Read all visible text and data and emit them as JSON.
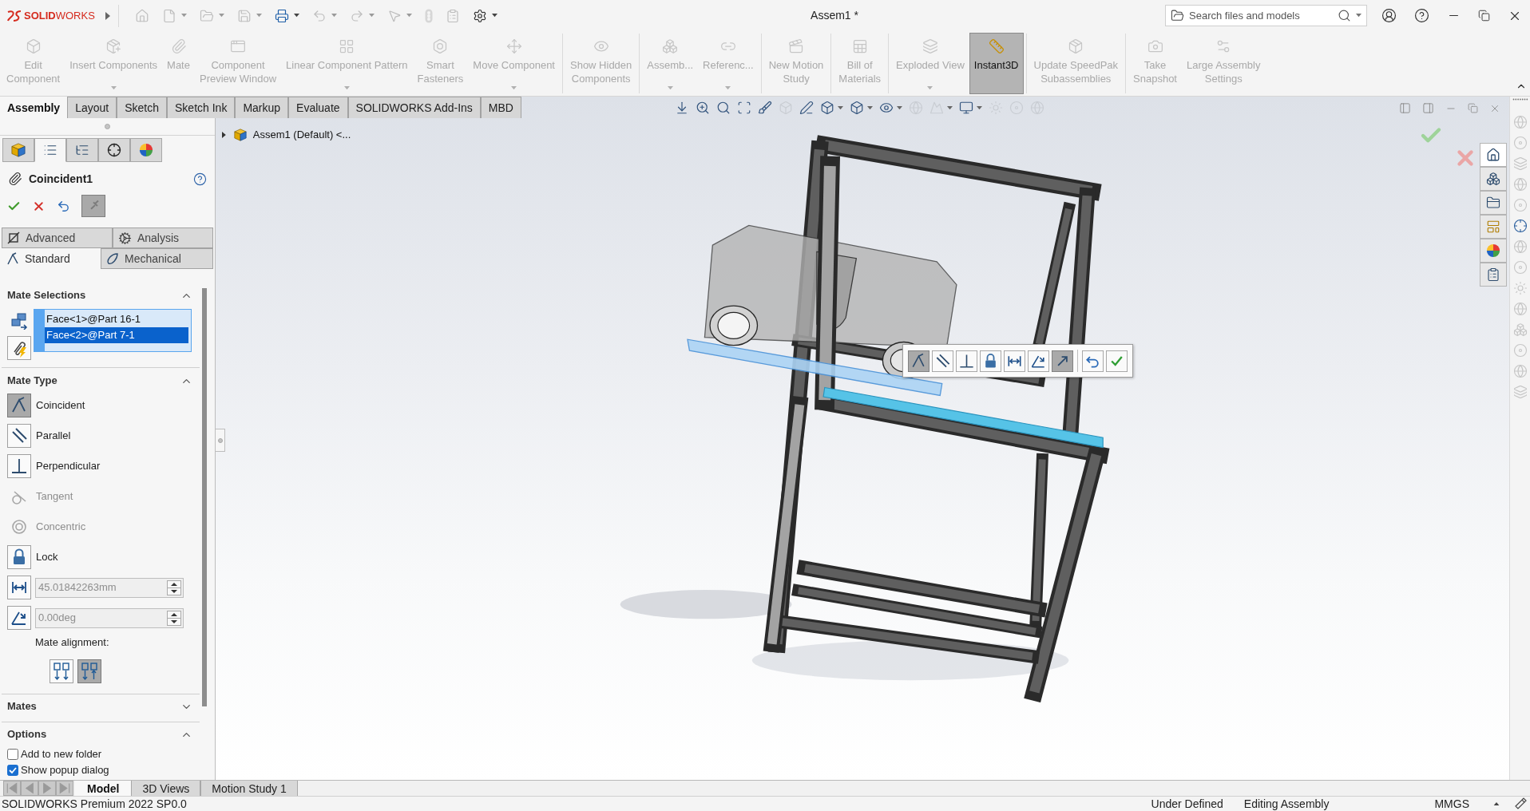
{
  "window": {
    "title": "Assem1 *"
  },
  "title_bar": {
    "logo": "**SOLID**WORKS",
    "quick_access": [
      {
        "disabled": true,
        "dropdown": false
      },
      {
        "disabled": true,
        "dropdown": true
      },
      {
        "disabled": true,
        "dropdown": true
      },
      {
        "disabled": true,
        "dropdown": true
      },
      {
        "disabled": false,
        "dropdown": true
      },
      {
        "disabled": true,
        "dropdown": true
      },
      {
        "disabled": true,
        "dropdown": true
      },
      {
        "disabled": true,
        "dropdown": true
      },
      {
        "disabled": true,
        "dropdown": false
      },
      {
        "disabled": true,
        "dropdown": false
      },
      {
        "disabled": false,
        "dropdown": true
      }
    ],
    "search": {
      "placeholder": "Search files and models"
    }
  },
  "ribbon": {
    "groups": [
      {
        "buttons": [
          {
            "label": "Edit\nComponent",
            "disabled": true,
            "selected": false,
            "dropdown": false
          },
          {
            "label": "Insert Components",
            "disabled": true,
            "selected": false,
            "dropdown": true
          },
          {
            "label": "Mate",
            "disabled": true,
            "selected": false,
            "dropdown": false
          },
          {
            "label": "Component\nPreview Window",
            "disabled": true,
            "selected": false,
            "dropdown": false
          },
          {
            "label": "Linear Component Pattern",
            "disabled": true,
            "selected": false,
            "dropdown": true
          },
          {
            "label": "Smart\nFasteners",
            "disabled": true,
            "selected": false,
            "dropdown": false
          },
          {
            "label": "Move Component",
            "disabled": true,
            "selected": false,
            "dropdown": true
          }
        ]
      },
      {
        "buttons": [
          {
            "label": "Show Hidden\nComponents",
            "disabled": true,
            "selected": false,
            "dropdown": false
          }
        ]
      },
      {
        "buttons": [
          {
            "label": "Assemb...",
            "disabled": true,
            "selected": false,
            "dropdown": true
          },
          {
            "label": "Referenc...",
            "disabled": true,
            "selected": false,
            "dropdown": true
          }
        ]
      },
      {
        "buttons": [
          {
            "label": "New Motion\nStudy",
            "disabled": true,
            "selected": false,
            "dropdown": false
          }
        ]
      },
      {
        "buttons": [
          {
            "label": "Bill of\nMaterials",
            "disabled": true,
            "selected": false,
            "dropdown": false
          }
        ]
      },
      {
        "buttons": [
          {
            "label": "Exploded View",
            "disabled": true,
            "selected": false,
            "dropdown": true
          },
          {
            "label": "Instant3D",
            "disabled": false,
            "selected": true,
            "dropdown": false
          }
        ]
      },
      {
        "buttons": [
          {
            "label": "Update SpeedPak\nSubassemblies",
            "disabled": true,
            "selected": false,
            "dropdown": false
          }
        ]
      },
      {
        "buttons": [
          {
            "label": "Take\nSnapshot",
            "disabled": true,
            "selected": false,
            "dropdown": false
          },
          {
            "label": "Large Assembly\nSettings",
            "disabled": true,
            "selected": false,
            "dropdown": false
          }
        ]
      }
    ]
  },
  "command_tabs": [
    {
      "label": "Assembly",
      "selected": true
    },
    {
      "label": "Layout",
      "selected": false
    },
    {
      "label": "Sketch",
      "selected": false
    },
    {
      "label": "Sketch Ink",
      "selected": false
    },
    {
      "label": "Markup",
      "selected": false
    },
    {
      "label": "Evaluate",
      "selected": false
    },
    {
      "label": "SOLIDWORKS Add-Ins",
      "selected": false
    },
    {
      "label": "MBD",
      "selected": false
    }
  ],
  "manager_tabs": [
    {
      "selected": false
    },
    {
      "selected": true
    },
    {
      "selected": false
    },
    {
      "selected": false
    },
    {
      "selected": false
    }
  ],
  "property_manager": {
    "title": "Coincident1",
    "pin": {
      "on": true
    },
    "mate_tabs": [
      {
        "label": "Advanced",
        "selected": false
      },
      {
        "label": "Analysis",
        "selected": false
      },
      {
        "label": "Standard",
        "selected": true
      },
      {
        "label": "Mechanical",
        "selected": false
      }
    ],
    "mate_selections": {
      "title": "Mate Selections",
      "expanded": true,
      "active": true,
      "items": [
        {
          "text": "Face<1>@Part 16-1",
          "selected": false
        },
        {
          "text": "Face<2>@Part 7-1",
          "selected": true
        }
      ]
    },
    "mate_type": {
      "title": "Mate Type",
      "expanded": true,
      "types": [
        {
          "label": "Coincident",
          "selected": true,
          "disabled": false
        },
        {
          "label": "Parallel",
          "selected": false,
          "disabled": false
        },
        {
          "label": "Perpendicular",
          "selected": false,
          "disabled": false
        },
        {
          "label": "Tangent",
          "selected": false,
          "disabled": true
        },
        {
          "label": "Concentric",
          "selected": false,
          "disabled": true
        },
        {
          "label": "Lock",
          "selected": false,
          "disabled": false
        }
      ],
      "distance": {
        "value": "45.01842263mm",
        "disabled": true
      },
      "angle": {
        "value": "0.00deg",
        "disabled": true
      },
      "alignment": {
        "label": "Mate alignment:",
        "options": [
          {
            "selected": false
          },
          {
            "selected": true
          }
        ]
      }
    },
    "mates": {
      "title": "Mates",
      "expanded": false
    },
    "options": {
      "title": "Options",
      "expanded": true,
      "checkboxes": [
        {
          "label": "Add to new folder",
          "checked": false
        },
        {
          "label": "Show popup dialog",
          "checked": true
        }
      ]
    }
  },
  "viewport_toolbar": [
    {
      "disabled": false,
      "dropdown": false
    },
    {
      "disabled": false,
      "dropdown": false
    },
    {
      "disabled": false,
      "dropdown": false
    },
    {
      "disabled": false,
      "dropdown": false
    },
    {
      "disabled": false,
      "dropdown": false
    },
    {
      "disabled": true,
      "dropdown": false
    },
    {
      "disabled": false,
      "dropdown": false
    },
    {
      "disabled": false,
      "dropdown": true
    },
    {
      "disabled": false,
      "dropdown": true
    },
    {
      "disabled": false,
      "dropdown": true
    },
    {
      "disabled": true,
      "dropdown": false
    },
    {
      "disabled": true,
      "dropdown": true
    },
    {
      "disabled": false,
      "dropdown": true
    },
    {
      "disabled": true,
      "dropdown": false
    },
    {
      "disabled": true,
      "dropdown": false
    },
    {
      "disabled": true,
      "dropdown": false
    }
  ],
  "feature_tree": {
    "label": "Assem1 (Default) <...",
    "expanded": false
  },
  "popup_toolbar": [
    {
      "selected": true
    },
    {
      "selected": false
    },
    {
      "selected": false
    },
    {
      "selected": false
    },
    {
      "selected": false
    },
    {
      "selected": false
    },
    {
      "selected": true
    },
    {
      "selected": false
    },
    {
      "selected": false
    }
  ],
  "task_pane": [
    {
      "selected": true
    },
    {
      "selected": false
    },
    {
      "selected": false
    },
    {
      "selected": false
    },
    {
      "selected": false
    },
    {
      "selected": false
    }
  ],
  "side_toolbar": [
    {
      "disabled": true
    },
    {
      "disabled": true
    },
    {
      "disabled": true
    },
    {
      "disabled": true
    },
    {
      "disabled": true
    },
    {
      "disabled": false
    },
    {
      "disabled": true
    },
    {
      "disabled": true
    },
    {
      "disabled": true
    },
    {
      "disabled": true
    },
    {
      "disabled": true
    },
    {
      "disabled": true
    },
    {
      "disabled": true
    },
    {
      "disabled": true
    }
  ],
  "bottom_tabs": [
    {
      "label": "Model",
      "selected": true
    },
    {
      "label": "3D Views",
      "selected": false
    },
    {
      "label": "Motion Study 1",
      "selected": false
    }
  ],
  "status_bar": {
    "product": "SOLIDWORKS Premium 2022 SP0.0",
    "items": [
      "Under Defined",
      "Editing Assembly"
    ],
    "units": "MMGS"
  }
}
